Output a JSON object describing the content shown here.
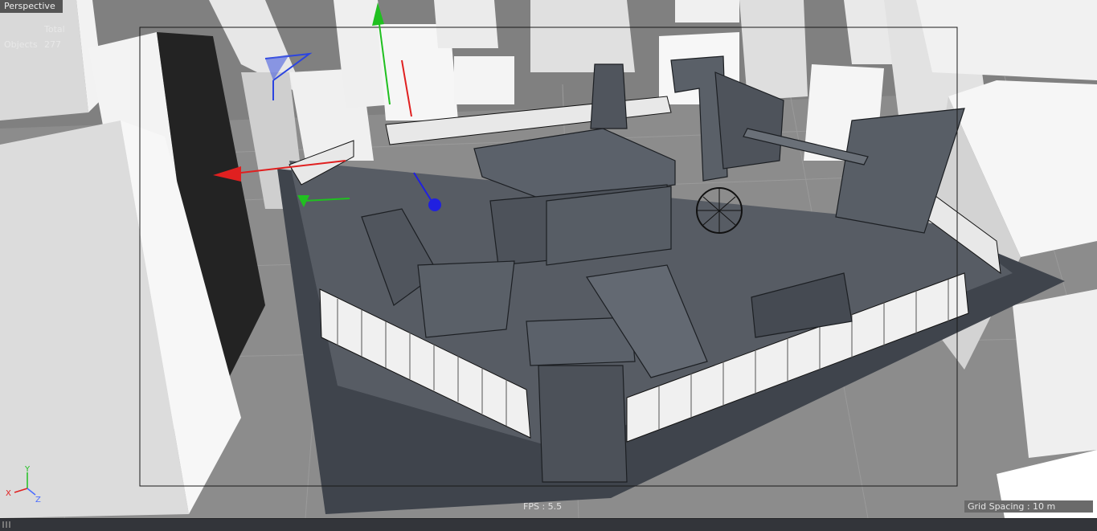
{
  "viewport": {
    "title": "Perspective",
    "hud": {
      "total_label": "Total",
      "objects_label": "Objects",
      "objects_value": "277"
    },
    "fps": "FPS : 5.5",
    "grid_spacing": "Grid Spacing : 10 m",
    "axis_labels": {
      "x": "X",
      "y": "Y",
      "z": "Z"
    }
  },
  "colors": {
    "background_gray": "#7d7d7d",
    "building_white": "#e6e6e6",
    "model_dark": "#4a4f57",
    "axis_x": "#e02020",
    "axis_y": "#20c020",
    "axis_z": "#2020e0"
  },
  "icons": {
    "move_gizmo": "move-gizmo-icon",
    "axis_indicator": "axis-gizmo-icon",
    "statusbar_grip": "grip-icon"
  }
}
